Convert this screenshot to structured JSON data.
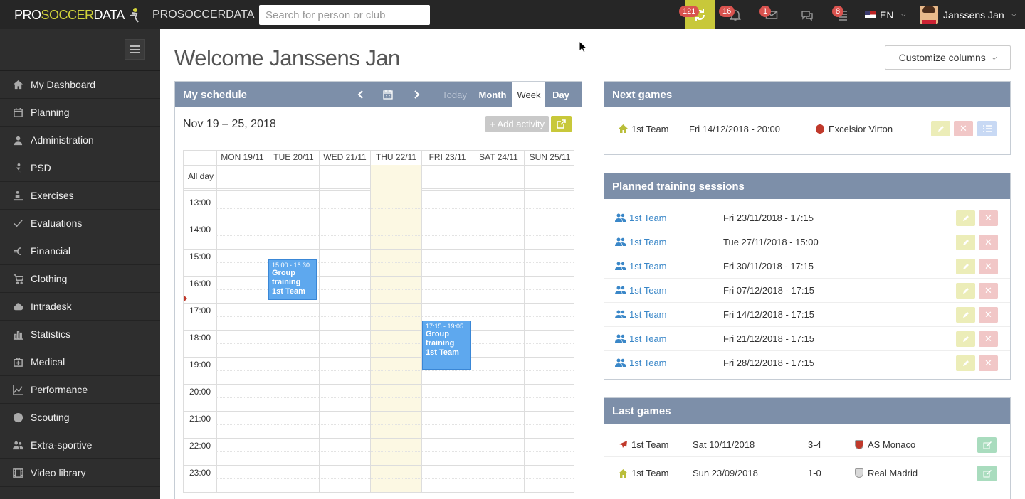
{
  "topbar": {
    "logo_pre": "PRO",
    "logo_mid": "SOCCER",
    "logo_post": "DATA",
    "brand": "PROSOCCERDATA",
    "search_placeholder": "Search for person or club",
    "badges": {
      "sync": "121",
      "alerts": "16",
      "mail": "1",
      "tasks": "8"
    },
    "language": "EN",
    "user_name": "Janssens Jan"
  },
  "sidebar": {
    "items": [
      {
        "label": "My Dashboard",
        "icon": "home-icon"
      },
      {
        "label": "Planning",
        "icon": "calendar-icon"
      },
      {
        "label": "Administration",
        "icon": "user-icon"
      },
      {
        "label": "PSD",
        "icon": "psd-icon"
      },
      {
        "label": "Exercises",
        "icon": "exercises-icon"
      },
      {
        "label": "Evaluations",
        "icon": "check-icon"
      },
      {
        "label": "Financial",
        "icon": "euro-icon"
      },
      {
        "label": "Clothing",
        "icon": "cart-icon"
      },
      {
        "label": "Intradesk",
        "icon": "cloud-icon"
      },
      {
        "label": "Statistics",
        "icon": "bar-chart-icon"
      },
      {
        "label": "Medical",
        "icon": "medkit-icon"
      },
      {
        "label": "Performance",
        "icon": "line-chart-icon"
      },
      {
        "label": "Scouting",
        "icon": "globe-icon"
      },
      {
        "label": "Extra-sportive",
        "icon": "users-icon"
      },
      {
        "label": "Video library",
        "icon": "film-icon"
      }
    ]
  },
  "page": {
    "welcome": "Welcome Janssens Jan",
    "customize_label": "Customize columns"
  },
  "schedule": {
    "title": "My schedule",
    "today": "Today",
    "month": "Month",
    "week": "Week",
    "day": "Day",
    "range": "Nov 19 – 25, 2018",
    "add_activity": "+ Add activity",
    "all_day": "All day",
    "days": [
      "MON 19/11",
      "TUE 20/11",
      "WED 21/11",
      "THU 22/11",
      "FRI 23/11",
      "SAT 24/11",
      "SUN 25/11"
    ],
    "hours": [
      "13:00",
      "14:00",
      "15:00",
      "16:00",
      "17:00",
      "18:00",
      "19:00",
      "20:00",
      "21:00",
      "22:00",
      "23:00"
    ],
    "events": [
      {
        "time": "15:00 - 16:30",
        "title": "Group training 1st Team",
        "day": 1,
        "start": 15.0,
        "end": 16.5
      },
      {
        "time": "17:15 - 19:05",
        "title": "Group training 1st Team",
        "day": 4,
        "start": 17.25,
        "end": 19.0833
      }
    ]
  },
  "next_games": {
    "title": "Next games",
    "rows": [
      {
        "team": "1st Team",
        "date": "Fri 14/12/2018 - 20:00",
        "opponent": "Excelsior Virton"
      }
    ]
  },
  "training": {
    "title": "Planned training sessions",
    "rows": [
      {
        "team": "1st Team",
        "date": "Fri 23/11/2018 - 17:15"
      },
      {
        "team": "1st Team",
        "date": "Tue 27/11/2018 - 15:00"
      },
      {
        "team": "1st Team",
        "date": "Fri 30/11/2018 - 17:15"
      },
      {
        "team": "1st Team",
        "date": "Fri 07/12/2018 - 17:15"
      },
      {
        "team": "1st Team",
        "date": "Fri 14/12/2018 - 17:15"
      },
      {
        "team": "1st Team",
        "date": "Fri 21/12/2018 - 17:15"
      },
      {
        "team": "1st Team",
        "date": "Fri 28/12/2018 - 17:15"
      }
    ]
  },
  "last_games": {
    "title": "Last games",
    "rows": [
      {
        "team": "1st Team",
        "date": "Sat 10/11/2018",
        "score": "3-4",
        "opponent": "AS Monaco",
        "icon": "plane-icon"
      },
      {
        "team": "1st Team",
        "date": "Sun 23/09/2018",
        "score": "1-0",
        "opponent": "Real Madrid",
        "icon": "home-icon"
      }
    ]
  },
  "colors": {
    "panel_header": "#7d8fa9",
    "accent_yellow": "#c8c83a",
    "event_blue": "#5ea8ee",
    "badge_red": "#d9534f"
  }
}
